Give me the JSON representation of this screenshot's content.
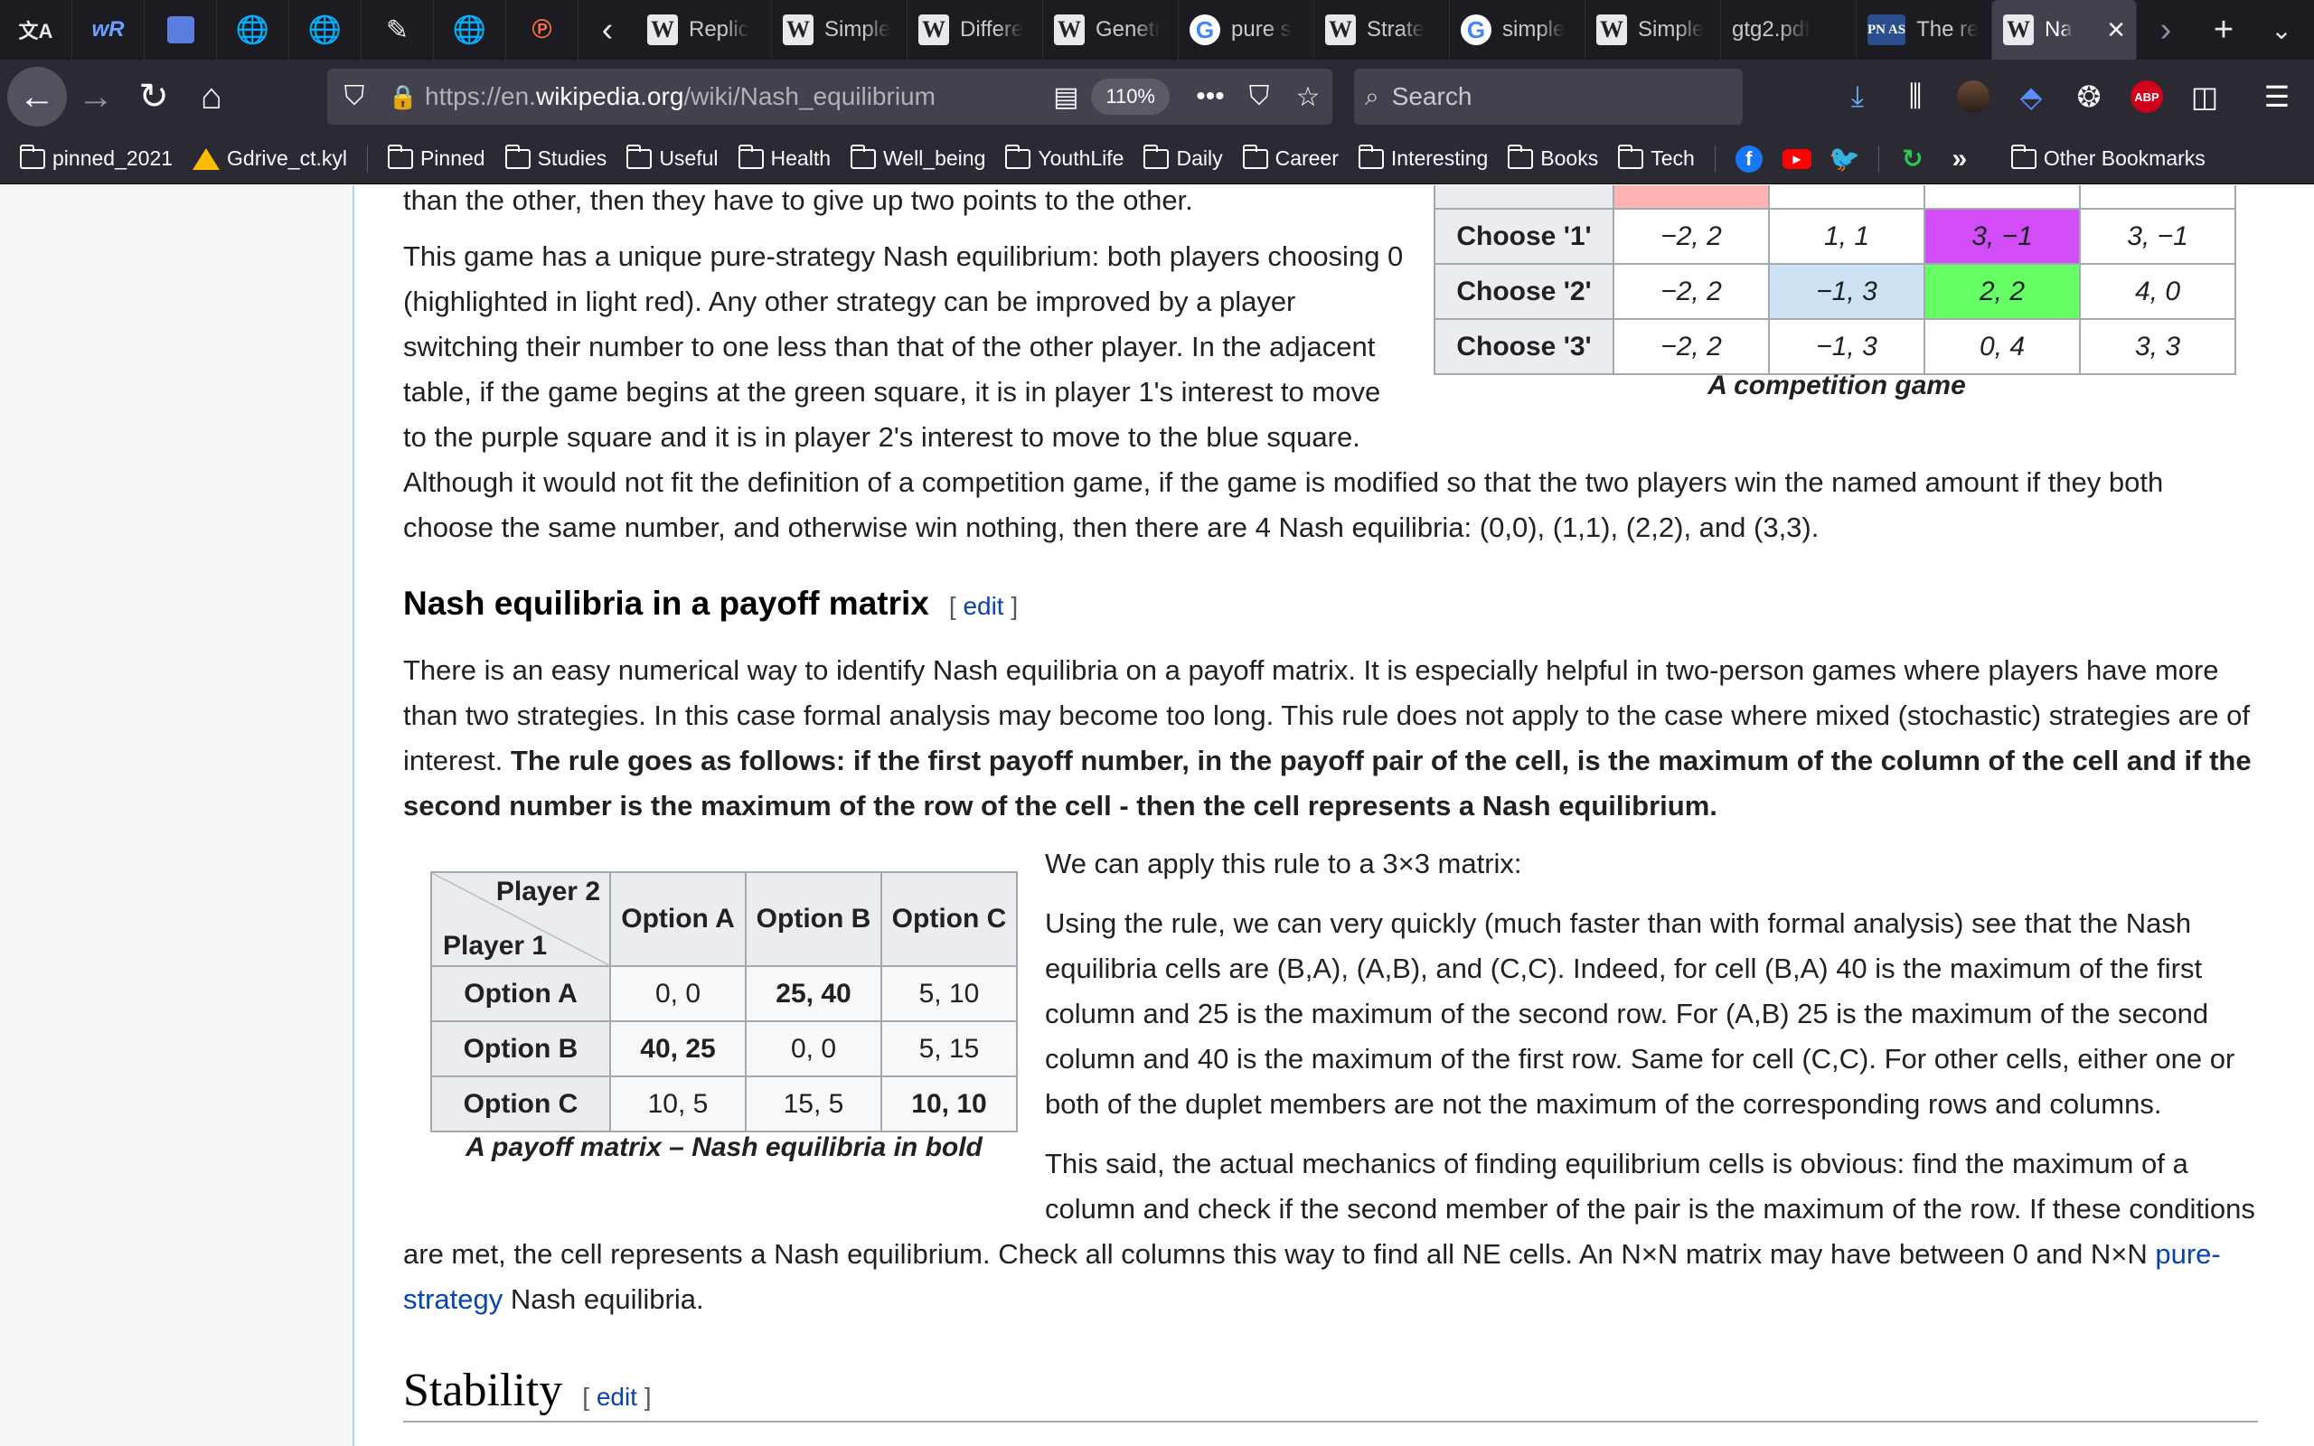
{
  "browser": {
    "tabs": [
      {
        "label": "Replic",
        "fav": "W"
      },
      {
        "label": "Simple",
        "fav": "W"
      },
      {
        "label": "Differe",
        "fav": "W"
      },
      {
        "label": "Geneti",
        "fav": "W"
      },
      {
        "label": "pure s",
        "fav": "G"
      },
      {
        "label": "Strate",
        "fav": "W"
      },
      {
        "label": "simple",
        "fav": "G"
      },
      {
        "label": "Simple",
        "fav": "W"
      },
      {
        "label": "gtg2.pdf",
        "fav": ""
      },
      {
        "label": "The re",
        "fav": "PN AS"
      },
      {
        "label": "Na",
        "fav": "W",
        "active": true
      }
    ],
    "url_prefix": "https://en.",
    "url_domain": "wikipedia.org",
    "url_path": "/wiki/Nash_equilibrium",
    "zoom": "110%",
    "search_placeholder": "Search",
    "abp_label": "ABP",
    "bookmarks": [
      {
        "label": "pinned_2021",
        "type": "folder"
      },
      {
        "label": "Gdrive_ct.kyl",
        "type": "drive"
      },
      {
        "label": "Pinned",
        "type": "folder"
      },
      {
        "label": "Studies",
        "type": "folder"
      },
      {
        "label": "Useful",
        "type": "folder"
      },
      {
        "label": "Health",
        "type": "folder"
      },
      {
        "label": "Well_being",
        "type": "folder"
      },
      {
        "label": "YouthLife",
        "type": "folder"
      },
      {
        "label": "Daily",
        "type": "folder"
      },
      {
        "label": "Career",
        "type": "folder"
      },
      {
        "label": "Interesting",
        "type": "folder"
      },
      {
        "label": "Books",
        "type": "folder"
      },
      {
        "label": "Tech",
        "type": "folder"
      }
    ],
    "other_bookmarks": "Other Bookmarks"
  },
  "article": {
    "p_top_fragment": "than the other, then they have to give up two points to the other.",
    "p_unique_lines": [
      "This game has a unique pure-strategy Nash equilibrium: both players choosing 0",
      "(highlighted in light red). Any other strategy can be improved by a player",
      "switching their number to one less than that of the other player. In the adjacent",
      "table, if the game begins at the green square, it is in player 1's interest to move",
      "to the purple square and it is in player 2's interest to move to the blue square."
    ],
    "p_although_lines": [
      "Although it would not fit the definition of a competition game, if the game is modified so that the two players win the named amount if they both",
      "choose the same number, and otherwise win nothing, then there are 4 Nash equilibria: (0,0), (1,1), (2,2), and (3,3)."
    ],
    "competition_table": {
      "rows": [
        {
          "label": "Choose '1'",
          "cells": [
            "−2, 2",
            "1, 1",
            "3, −1",
            "3, −1"
          ]
        },
        {
          "label": "Choose '2'",
          "cells": [
            "−2, 2",
            "−1, 3",
            "2, 2",
            "4, 0"
          ]
        },
        {
          "label": "Choose '3'",
          "cells": [
            "−2, 2",
            "−1, 3",
            "0, 4",
            "3, 3"
          ]
        }
      ],
      "caption": "A competition game"
    },
    "section_payoff": {
      "title": "Nash equilibria in a payoff matrix",
      "edit_open": "[",
      "edit_label": "edit",
      "edit_close": "]"
    },
    "p_easy_lines": [
      "There is an easy numerical way to identify Nash equilibria on a payoff matrix. It is especially helpful in two-person games where players have more",
      "than two strategies. In this case formal analysis may become too long. This rule does not apply to the case where mixed (stochastic) strategies are of"
    ],
    "p_easy_line3_plain": "interest.",
    "p_easy_line3_bold": "The rule goes as follows: if the first payoff number, in the payoff pair of the cell, is the maximum of the column of the cell and if the",
    "p_easy_line4_bold": "second number is the maximum of the row of the cell - then the cell represents a Nash equilibrium.",
    "payoff_table": {
      "corner_top": "Player 2",
      "corner_bottom": "Player 1",
      "columns": [
        "Option A",
        "Option B",
        "Option C"
      ],
      "rows": [
        {
          "label": "Option A",
          "cells": [
            "0, 0",
            "25, 40",
            "5, 10"
          ],
          "bold": [
            false,
            true,
            false
          ]
        },
        {
          "label": "Option B",
          "cells": [
            "40, 25",
            "0, 0",
            "5, 15"
          ],
          "bold": [
            true,
            false,
            false
          ]
        },
        {
          "label": "Option C",
          "cells": [
            "10, 5",
            "15, 5",
            "10, 10"
          ],
          "bold": [
            false,
            false,
            true
          ]
        }
      ],
      "caption": "A payoff matrix – Nash equilibria in bold"
    },
    "p_apply": "We can apply this rule to a 3×3 matrix:",
    "p_using_lines": [
      "Using the rule, we can very quickly (much faster than with formal analysis) see that the Nash",
      "equilibria cells are (B,A), (A,B), and (C,C). Indeed, for cell (B,A) 40 is the maximum of the first",
      "column and 25 is the maximum of the second row. For (A,B) 25 is the maximum of the second",
      "column and 40 is the maximum of the first row. Same for cell (C,C). For other cells, either one or",
      "both of the duplet members are not the maximum of the corresponding rows and columns."
    ],
    "p_said_lines": [
      "This said, the actual mechanics of finding equilibrium cells is obvious: find the maximum of a",
      "column and check if the second member of the pair is the maximum of the row. If these conditions"
    ],
    "p_said_line3_plain": "are met, the cell represents a Nash equilibrium. Check all columns this way to find all NE cells. An N×N matrix may have between 0 and N×N",
    "p_said_link1": "pure-",
    "p_said_link2": "strategy",
    "p_said_tail": "Nash equilibria.",
    "section_stability": {
      "title": "Stability",
      "edit_open": "[",
      "edit_label": "edit",
      "edit_close": "]"
    }
  }
}
